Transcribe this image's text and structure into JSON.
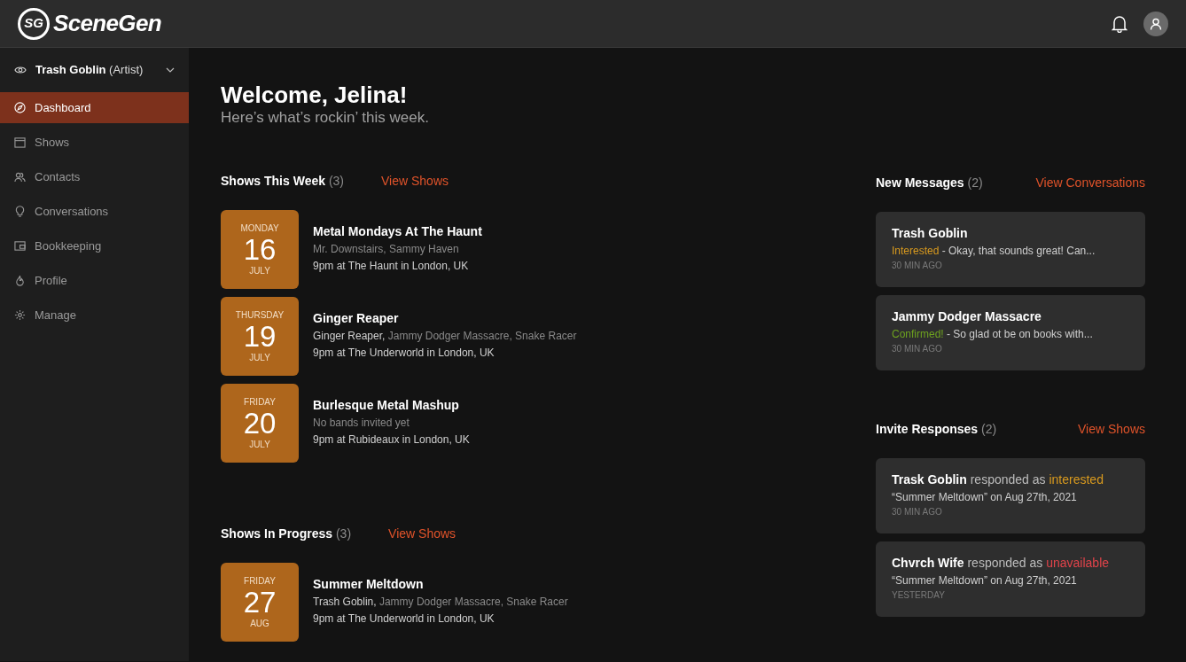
{
  "header": {
    "logo_mark": "SG",
    "logo": "SceneGen"
  },
  "sidebar": {
    "account": {
      "name": "Trash Goblin",
      "role": "(Artist)",
      "expanded": false
    },
    "items": [
      {
        "label": "Dashboard",
        "selected": true
      },
      {
        "label": "Shows",
        "selected": false
      },
      {
        "label": "Contacts",
        "selected": false
      },
      {
        "label": "Conversations",
        "selected": false
      },
      {
        "label": "Bookkeeping",
        "selected": false
      },
      {
        "label": "Profile",
        "selected": false
      },
      {
        "label": "Manage",
        "selected": false
      }
    ]
  },
  "welcome": {
    "title": "Welcome, Jelina!",
    "subtitle": "Here’s what’s rockin’ this week."
  },
  "show_sections": [
    {
      "title": "Shows This Week",
      "count": "(3)",
      "link": "View Shows",
      "shows": [
        {
          "weekday": "MONDAY",
          "day": "16",
          "month": "JULY",
          "name": "Metal Mondays At The Haunt",
          "others": "Mr. Downstairs, Sammy Haven",
          "where": "9pm at The Haunt in London, UK"
        },
        {
          "weekday": "THURSDAY",
          "day": "19",
          "month": "JULY",
          "name": "Ginger Reaper",
          "own": "Ginger Reaper,",
          "others": "Jammy Dodger Massacre, Snake Racer",
          "where": "9pm at The Underworld in London, UK"
        },
        {
          "weekday": "FRIDAY",
          "day": "20",
          "month": "JULY",
          "name": "Burlesque Metal Mashup",
          "others": "No bands invited yet",
          "where": "9pm at Rubideaux in London, UK"
        }
      ]
    },
    {
      "title": "Shows In Progress",
      "count": "(3)",
      "link": "View Shows",
      "shows": [
        {
          "weekday": "FRIDAY",
          "day": "27",
          "month": "AUG",
          "name": "Summer Meltdown",
          "own": "Trash Goblin,",
          "others": "Jammy Dodger Massacre, Snake Racer",
          "where": "9pm at The Underworld in London, UK"
        }
      ]
    }
  ],
  "messages": {
    "title": "New Messages",
    "count": "(2)",
    "link": "View Conversations",
    "items": [
      {
        "sender": "Trash Goblin",
        "status": "Interested",
        "color": "#d99a1e",
        "preview": " - Okay, that sounds great! Can...",
        "time": "30 MIN AGO"
      },
      {
        "sender": "Jammy Dodger Massacre",
        "status": "Confirmed!",
        "color": "#6ea31f",
        "preview": " - So glad ot be on books with...",
        "time": "30 MIN AGO"
      }
    ]
  },
  "invites": {
    "title": "Invite Responses",
    "count": "(2)",
    "link": "View Shows",
    "items": [
      {
        "text": "**Trask Goblin** responded as",
        "status": "interested",
        "color": "#d99a1e",
        "show": "“Summer Meltdown” on Aug 27th, 2021",
        "time": "30 MIN AGO"
      },
      {
        "text": "**Chvrch Wife** responded as",
        "status": "unavailable",
        "color": "#e0434a",
        "show": "“Summer Meltdown” on Aug 27th, 2021",
        "time": "YESTERDAY"
      }
    ]
  }
}
